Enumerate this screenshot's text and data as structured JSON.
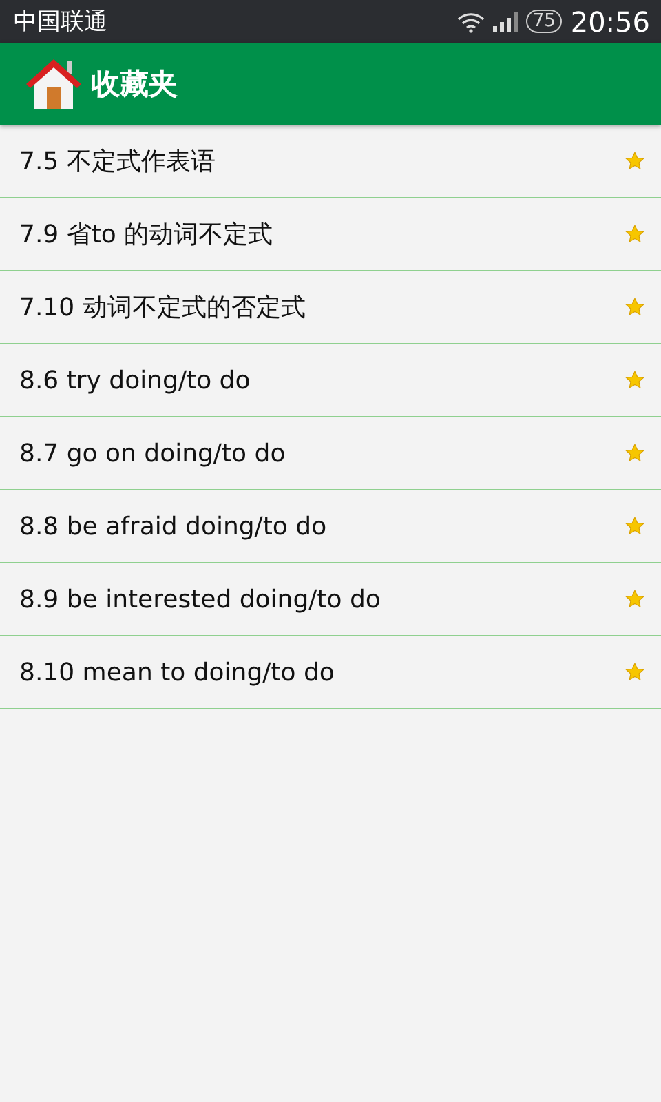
{
  "status_bar": {
    "carrier": "中国联通",
    "battery": "75",
    "time": "20:56"
  },
  "header": {
    "title": "收藏夹"
  },
  "items": [
    {
      "label": "7.5 不定式作表语"
    },
    {
      "label": "7.9 省to 的动词不定式"
    },
    {
      "label": "7.10 动词不定式的否定式"
    },
    {
      "label": "8.6 try doing/to do"
    },
    {
      "label": "8.7 go on doing/to do"
    },
    {
      "label": "8.8 be afraid doing/to do"
    },
    {
      "label": "8.9 be interested doing/to do"
    },
    {
      "label": "8.10 mean to doing/to do"
    }
  ]
}
